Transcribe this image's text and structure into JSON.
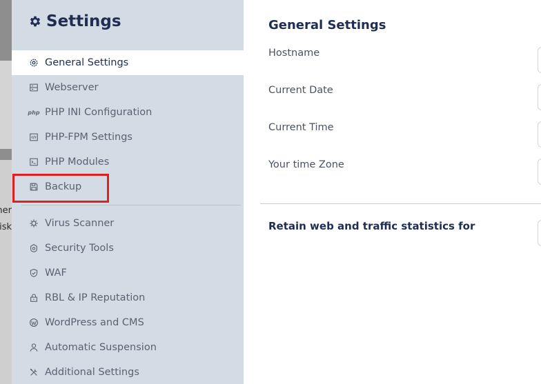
{
  "sidebar": {
    "title": "Settings",
    "items_top": [
      {
        "label": "General Settings",
        "icon": "gear-icon",
        "active": true
      },
      {
        "label": "Webserver",
        "icon": "server-icon"
      },
      {
        "label": "PHP INI Configuration",
        "icon": "php-icon",
        "icon_text": "php"
      },
      {
        "label": "PHP-FPM Settings",
        "icon": "code-icon"
      },
      {
        "label": "PHP Modules",
        "icon": "terminal-icon"
      },
      {
        "label": "Backup",
        "icon": "save-icon"
      }
    ],
    "items_bottom": [
      {
        "label": "Virus Scanner",
        "icon": "virus-icon"
      },
      {
        "label": "Security Tools",
        "icon": "security-icon"
      },
      {
        "label": "WAF",
        "icon": "shield-icon"
      },
      {
        "label": "RBL & IP Reputation",
        "icon": "lock-icon"
      },
      {
        "label": "WordPress and CMS",
        "icon": "wordpress-icon"
      },
      {
        "label": "Automatic Suspension",
        "icon": "user-icon"
      },
      {
        "label": "Additional Settings",
        "icon": "tools-icon"
      }
    ]
  },
  "main": {
    "title": "General Settings",
    "fields": [
      {
        "label": "Hostname",
        "value": ""
      },
      {
        "label": "Current Date",
        "value": ""
      },
      {
        "label": "Current Time",
        "value": ""
      },
      {
        "label": "Your time Zone",
        "value": ""
      }
    ],
    "retain_label": "Retain web and traffic statistics for"
  },
  "background": {
    "text_1": "her",
    "text_2": "isk"
  },
  "colors": {
    "sidebar_bg": "#d3dce5",
    "heading": "#1f2d52",
    "highlight": "#e02020"
  }
}
